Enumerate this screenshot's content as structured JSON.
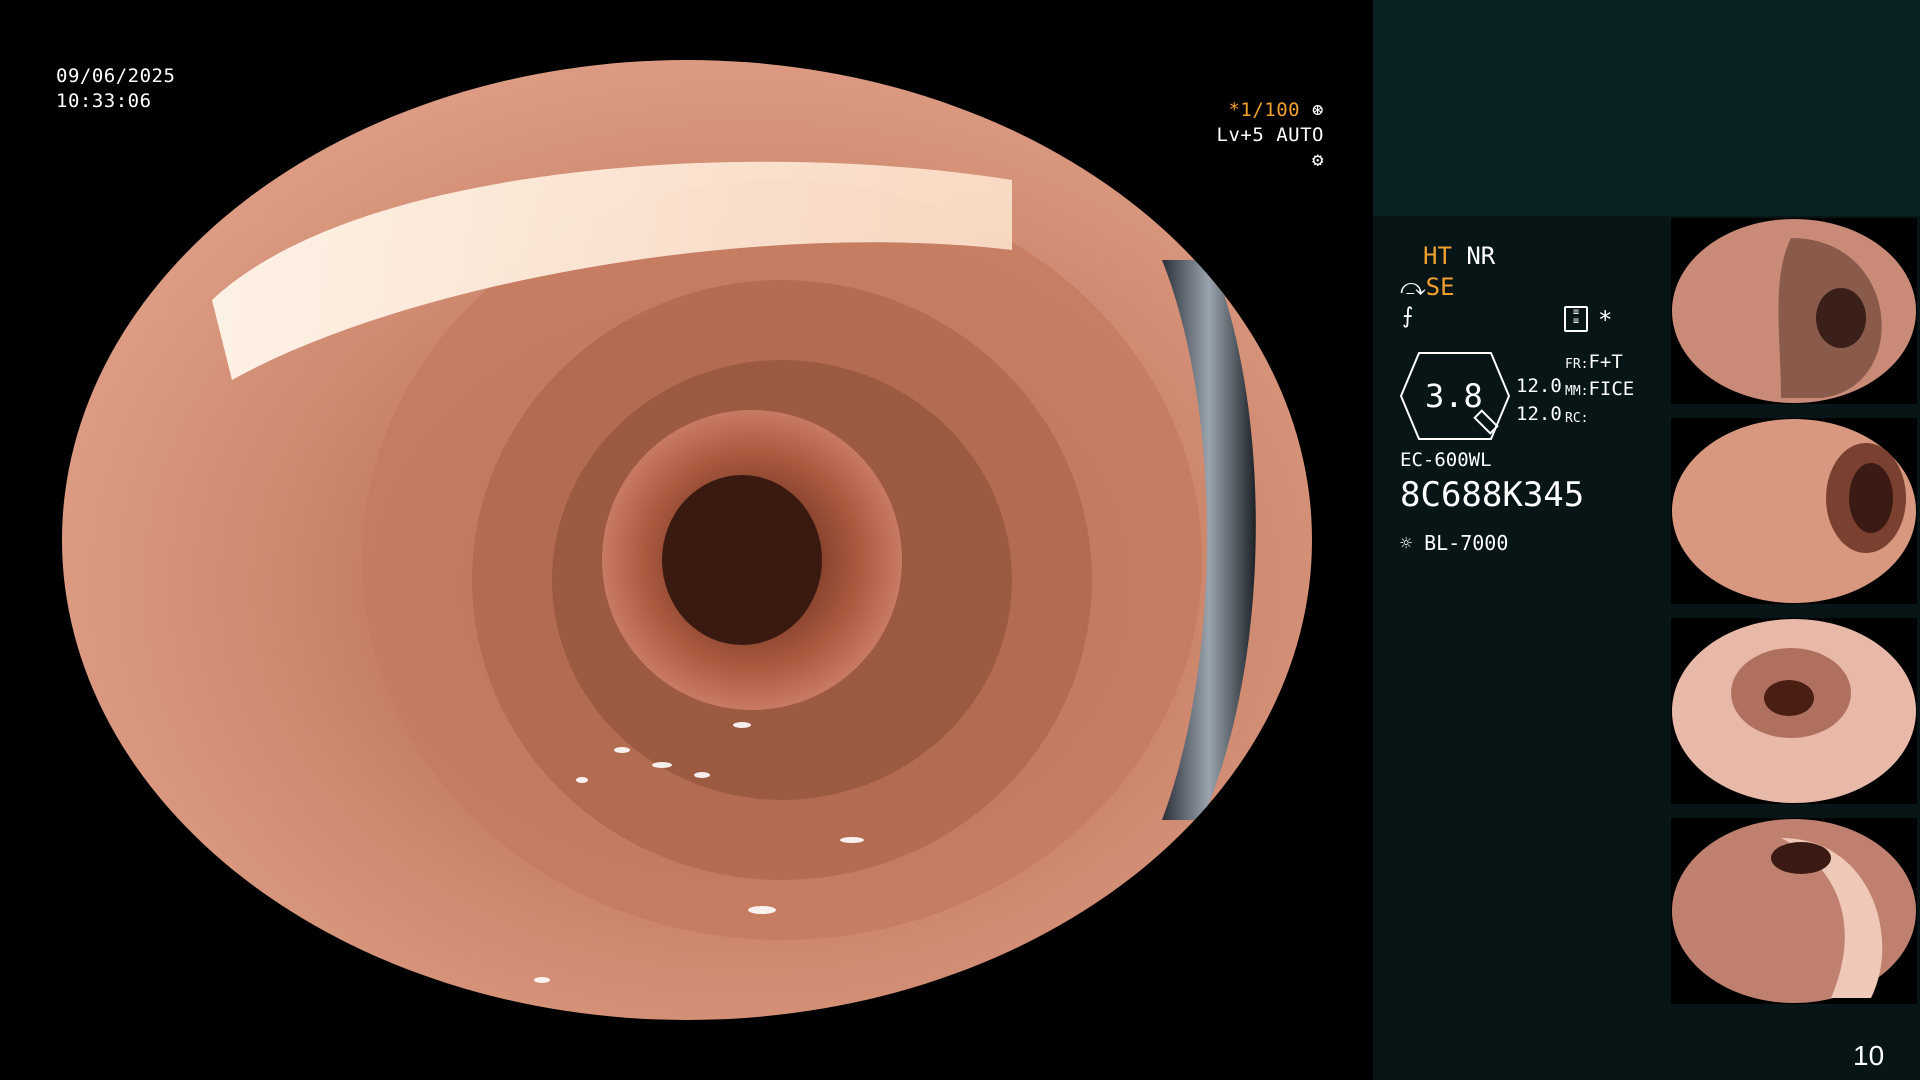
{
  "overlay": {
    "date": "09/06/2025",
    "time": "10:33:06",
    "shutter": "*1/100",
    "level": "Lv+5",
    "mode": "AUTO"
  },
  "panel": {
    "ht": "HT",
    "nr": "NR",
    "se": "SE",
    "star": "*",
    "zoom": "3.8",
    "val1": "12.0",
    "val2": "12.0",
    "fr_label": "FR:",
    "fr_value": "F+T",
    "mm_label": "MM:",
    "mm_value": "FICE",
    "rc_label": "RC:",
    "scope_model": "EC-600WL",
    "serial": "8C688K345",
    "light_source": "BL-7000",
    "page_number": "10"
  },
  "colors": {
    "accent_orange": "#f0a030",
    "panel_bg": "#071517",
    "panel_top_bg": "#0b2224"
  },
  "icons": [
    "aperture-icon",
    "gear-icon",
    "se-curve-icon",
    "fast-icon",
    "settings-card-icon",
    "light-source-icon",
    "magnifier-icon"
  ]
}
